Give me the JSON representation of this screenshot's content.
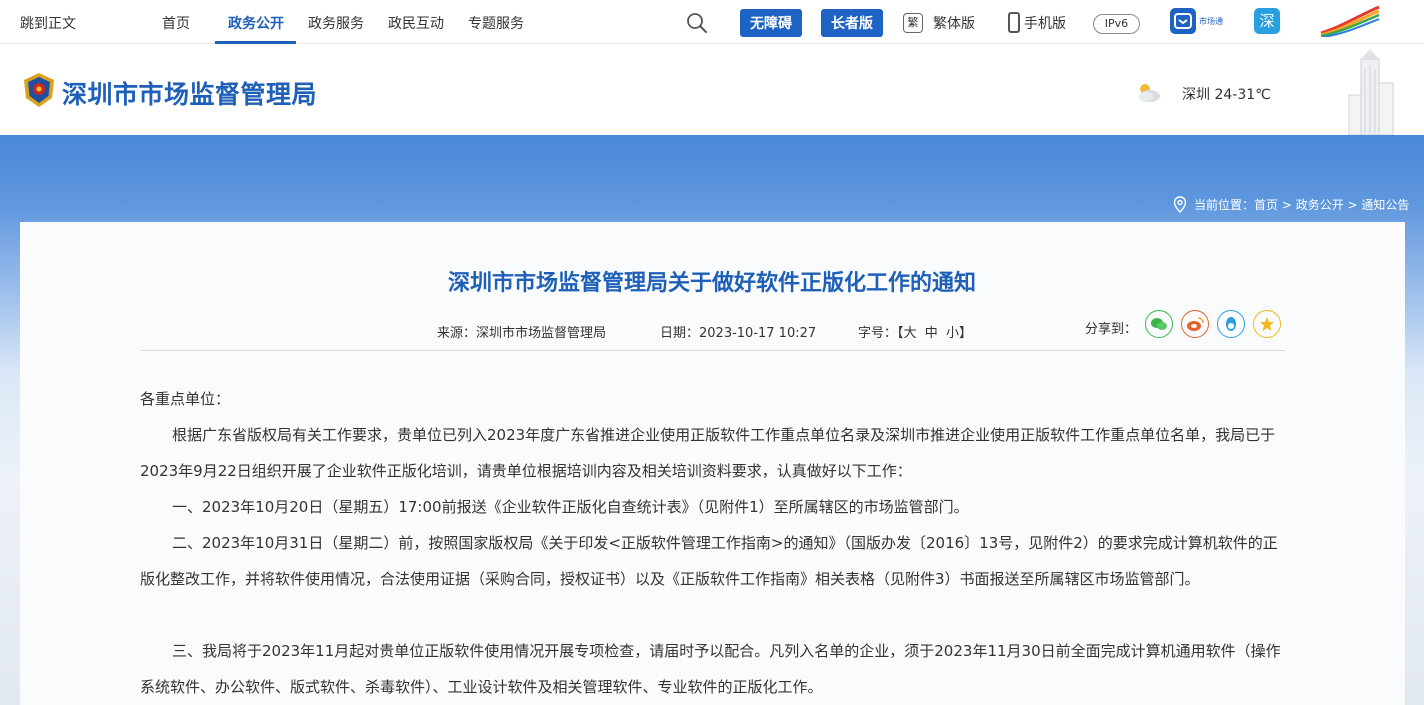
{
  "topnav": {
    "skip_link": "跳到正文",
    "items": [
      {
        "label": "首页"
      },
      {
        "label": "政务公开"
      },
      {
        "label": "政务服务"
      },
      {
        "label": "政民互动"
      },
      {
        "label": "专题服务"
      }
    ],
    "active_item": "政务公开",
    "accessibility_button": "无障碍",
    "elder_button": "长者版",
    "traditional_icon_glyph": "繁",
    "traditional_label": "繁体版",
    "mobile_label": "手机版",
    "ipv6_label": "IPv6",
    "app1_label": "市场通",
    "app2_glyph": "深"
  },
  "header": {
    "site_title": "深圳市市场监督管理局",
    "weather": "深圳 24-31℃"
  },
  "breadcrumb": {
    "label": "当前位置：",
    "items": [
      "首页",
      "政务公开",
      "通知公告"
    ],
    "separator": " > "
  },
  "article": {
    "title": "深圳市市场监督管理局关于做好软件正版化工作的通知",
    "source": "来源：深圳市市场监督管理局",
    "date": "日期：2023-10-17 10:27",
    "fontsize": "字号：【大  中  小】",
    "share_label": "分享到：",
    "salutation": "各重点单位：",
    "paragraphs": [
      "根据广东省版权局有关工作要求，贵单位已列入2023年度广东省推进企业使用正版软件工作重点单位名录及深圳市推进企业使用正版软件工作重点单位名单，我局已于2023年9月22日组织开展了企业软件正版化培训，请贵单位根据培训内容及相关培训资料要求，认真做好以下工作：",
      "一、2023年10月20日（星期五）17:00前报送《企业软件正版化自查统计表》（见附件1）至所属辖区的市场监管部门。",
      "二、2023年10月31日（星期二）前，按照国家版权局《关于印发<正版软件管理工作指南>的通知》（国版办发〔2016〕13号，见附件2）的要求完成计算机软件的正版化整改工作，并将软件使用情况，合法使用证据（采购合同，授权证书）以及《正版软件工作指南》相关表格（见附件3）书面报送至所属辖区市场监管部门。",
      "三、我局将于2023年11月起对贵单位正版软件使用情况开展专项检查，请届时予以配合。凡列入名单的企业，须于2023年11月30日前全面完成计算机通用软件（操作系统软件、办公软件、版式软件、杀毒软件）、工业设计软件及相关管理软件、专业软件的正版化工作。"
    ]
  },
  "colors": {
    "brand_blue": "#1e5fb8",
    "button_blue": "#1e63c4",
    "wechat_green": "#3bb54a",
    "weibo_orange": "#e8602c",
    "qq_blue": "#2a9fe0",
    "star_yellow": "#f2b81c"
  }
}
